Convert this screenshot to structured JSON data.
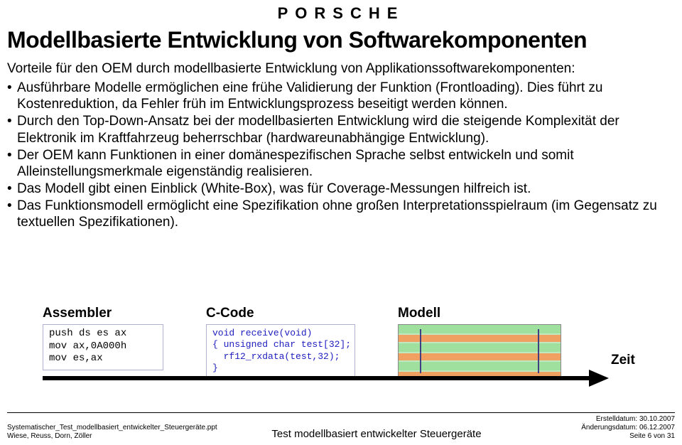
{
  "logo": "PORSCHE",
  "title": "Modellbasierte Entwicklung von Softwarekomponenten",
  "subtitle": "Vorteile für den OEM durch modellbasierte Entwicklung von Applikationssoftwarekomponenten:",
  "bullets": [
    "Ausführbare Modelle ermöglichen eine frühe Validierung der Funktion (Frontloading). Dies führt zu Kostenreduktion, da Fehler früh im Entwicklungsprozess beseitigt werden können.",
    "Durch den Top-Down-Ansatz bei der modellbasierten Entwicklung wird die steigende Komplexität der Elektronik im Kraftfahrzeug beherrschbar (hardwareunabhängige Entwicklung).",
    "Der OEM kann Funktionen in einer domänespezifischen Sprache selbst entwickeln und somit Alleinstellungsmerkmale eigenständig realisieren.",
    "Das Modell gibt einen Einblick (White-Box), was für Coverage-Messungen hilfreich ist.",
    "Das Funktionsmodell ermöglicht eine Spezifikation ohne großen Interpretationsspielraum (im Gegensatz zu textuellen Spezifikationen)."
  ],
  "code": {
    "asm_heading": "Assembler",
    "asm_body": "push ds es ax\nmov ax,0A000h\nmov es,ax",
    "c_heading": "C-Code",
    "c_body": "void receive(void)\n{ unsigned char test[32];\n  rf12_rxdata(test,32);\n}",
    "model_heading": "Modell"
  },
  "timeline_label": "Zeit",
  "footer": {
    "filename": "Systematischer_Test_modellbasiert_entwickelter_Steuergeräte.ppt",
    "authors": "Wiese, Reuss, Dorn, Zöller",
    "center": "Test modellbasiert entwickelter Steuergeräte",
    "created": "Erstelldatum: 30.10.2007",
    "modified": "Änderungsdatum: 06.12.2007",
    "page": "Seite 6 von 31"
  }
}
